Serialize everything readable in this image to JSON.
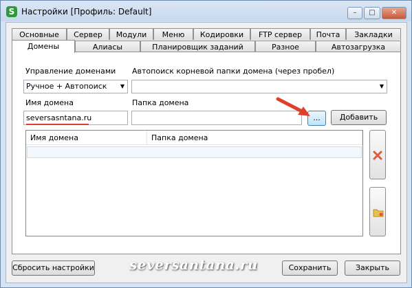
{
  "window": {
    "title": "Настройки [Профиль: Default]",
    "app_icon_letter": "S",
    "minimize": "–",
    "maximize": "□",
    "close": "✕"
  },
  "tabs_row1": [
    "Основные",
    "Сервер",
    "Модули",
    "Меню",
    "Кодировки",
    "FTP сервер",
    "Почта",
    "Закладки"
  ],
  "tabs_row2": [
    "Домены",
    "Алиасы",
    "Планировщик заданий",
    "Разное",
    "Автозагрузка"
  ],
  "active_tab": "Домены",
  "domains": {
    "management_label": "Управление доменами",
    "management_value": "Ручное + Автопоиск",
    "autosearch_label": "Автопоиск корневой папки домена (через пробел)",
    "autosearch_value": "",
    "domain_name_label": "Имя домена",
    "domain_name_value": "seversasntana.ru",
    "domain_folder_label": "Папка домена",
    "domain_folder_value": "",
    "browse_button": "...",
    "add_button": "Добавить",
    "table_headers": [
      "Имя домена",
      "Папка домена"
    ],
    "rows": []
  },
  "footer": {
    "reset_button": "Сбросить настройки",
    "save_button": "Сохранить",
    "close_button": "Закрыть"
  },
  "watermark": "seversantana.ru",
  "colors": {
    "annotation_red": "#e0402a",
    "delete_icon": "#e05a3a",
    "folder_icon": "#e8c04a"
  }
}
